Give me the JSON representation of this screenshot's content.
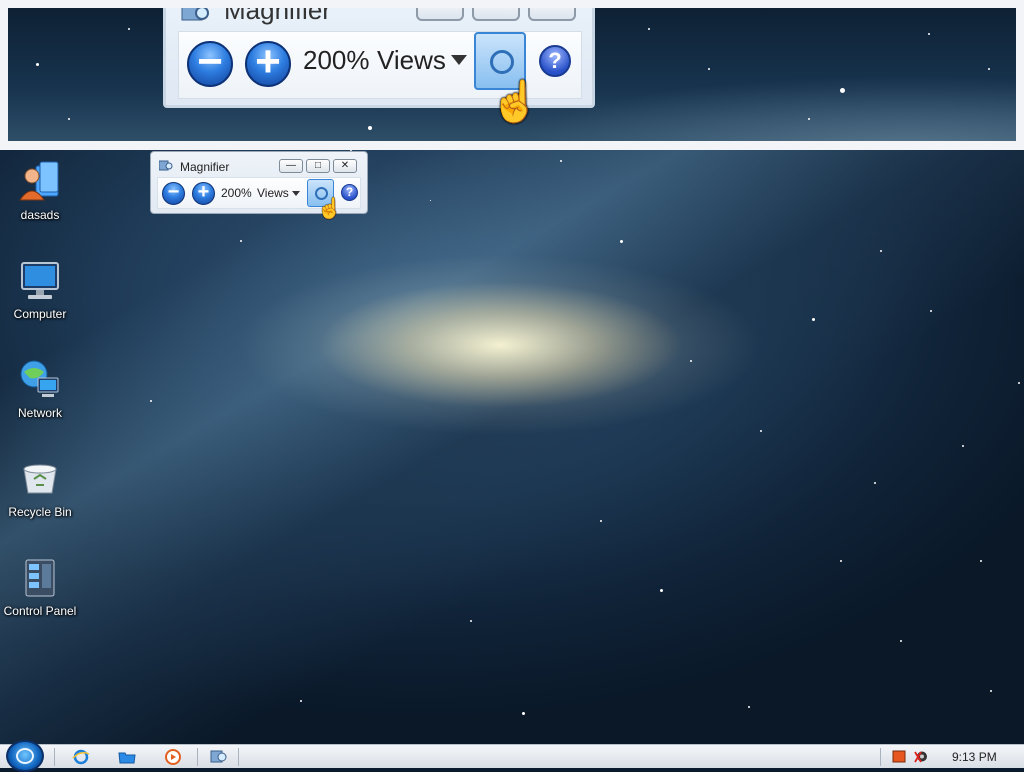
{
  "magnified_view": {
    "window_title": "Magnifier",
    "zoom_text": "200%",
    "views_label": "Views"
  },
  "desktop_icons": [
    {
      "label": "dasads",
      "icon": "user-folder-icon"
    },
    {
      "label": "Computer",
      "icon": "computer-icon"
    },
    {
      "label": "Network",
      "icon": "network-icon"
    },
    {
      "label": "Recycle Bin",
      "icon": "recycle-bin-icon"
    },
    {
      "label": "Control Panel",
      "icon": "control-panel-icon"
    }
  ],
  "magnifier_window": {
    "title": "Magnifier",
    "zoom_out_symbol": "−",
    "zoom_in_symbol": "+",
    "zoom_text": "200%",
    "views_label": "Views",
    "help_symbol": "?",
    "minimize_symbol": "—",
    "maximize_symbol": "□",
    "close_symbol": "✕"
  },
  "taskbar": {
    "clock": "9:13 PM"
  },
  "colors": {
    "accent_blue": "#2d7de0",
    "lens_button": "#87bff0",
    "taskbar": "#d9dfe6"
  }
}
